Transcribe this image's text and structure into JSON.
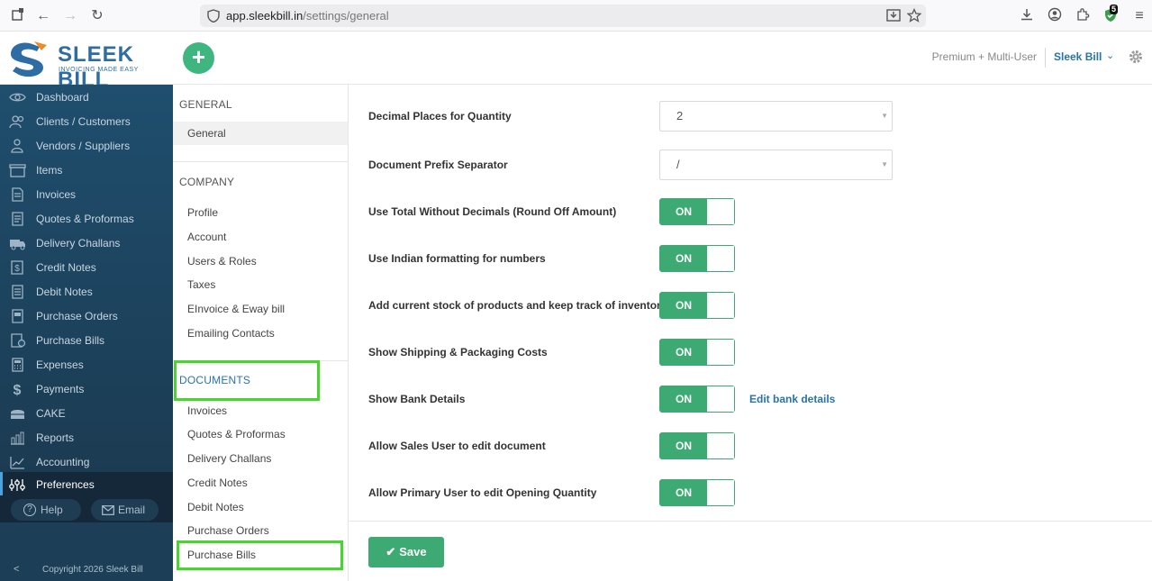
{
  "browser": {
    "url_domain": "app.sleekbill.in",
    "url_path": "/settings/general",
    "extension_badge": "5"
  },
  "header": {
    "logo_word": "SLEEK BILL",
    "logo_tagline": "INVOICING MADE EASY",
    "add_label": "+",
    "plan": "Premium + Multi-User",
    "user": "Sleek Bill"
  },
  "sidebar": {
    "items": [
      {
        "label": "Dashboard"
      },
      {
        "label": "Clients / Customers"
      },
      {
        "label": "Vendors / Suppliers"
      },
      {
        "label": "Items"
      },
      {
        "label": "Invoices"
      },
      {
        "label": "Quotes & Proformas"
      },
      {
        "label": "Delivery Challans"
      },
      {
        "label": "Credit Notes"
      },
      {
        "label": "Debit Notes"
      },
      {
        "label": "Purchase Orders"
      },
      {
        "label": "Purchase Bills"
      },
      {
        "label": "Expenses"
      },
      {
        "label": "Payments"
      },
      {
        "label": "CAKE"
      },
      {
        "label": "Reports"
      },
      {
        "label": "Accounting"
      },
      {
        "label": "Preferences"
      }
    ],
    "help": "Help",
    "email": "Email",
    "collapse": "<",
    "copyright": "Copyright 2026 Sleek Bill"
  },
  "settings_nav": {
    "general_head": "GENERAL",
    "general_items": [
      "General"
    ],
    "company_head": "COMPANY",
    "company_items": [
      "Profile",
      "Account",
      "Users & Roles",
      "Taxes",
      "EInvoice & Eway bill",
      "Emailing Contacts"
    ],
    "documents_head": "DOCUMENTS",
    "documents_items": [
      "Invoices",
      "Quotes & Proformas",
      "Delivery Challans",
      "Credit Notes",
      "Debit Notes",
      "Purchase Orders",
      "Purchase Bills"
    ]
  },
  "main": {
    "decimal_label": "Decimal Places for Quantity",
    "decimal_value": "2",
    "prefix_label": "Document Prefix Separator",
    "prefix_value": "/",
    "toggles": [
      {
        "label": "Use Total Without Decimals (Round Off Amount)",
        "state": "ON"
      },
      {
        "label": "Use Indian formatting for numbers",
        "state": "ON"
      },
      {
        "label": "Add current stock of products and keep track of inventory",
        "state": "ON"
      },
      {
        "label": "Show Shipping & Packaging Costs",
        "state": "ON"
      },
      {
        "label": "Show Bank Details",
        "state": "ON"
      },
      {
        "label": "Allow Sales User to edit document",
        "state": "ON"
      },
      {
        "label": "Allow Primary User to edit Opening Quantity",
        "state": "ON"
      }
    ],
    "edit_bank_link": "Edit bank details",
    "save_label": "Save"
  },
  "colors": {
    "accent_green": "#3daa74",
    "sidebar": "#1f4e6e",
    "link_blue": "#2874a6",
    "highlight": "#46d62e"
  }
}
